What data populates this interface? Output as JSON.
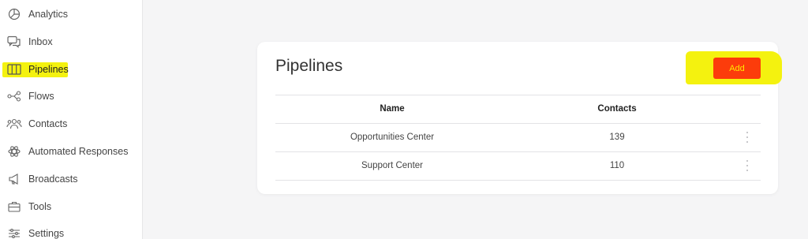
{
  "sidebar": {
    "items": [
      {
        "label": "Analytics",
        "icon": "analytics-icon"
      },
      {
        "label": "Inbox",
        "icon": "inbox-icon"
      },
      {
        "label": "Pipelines",
        "icon": "pipelines-icon",
        "active": true
      },
      {
        "label": "Flows",
        "icon": "flows-icon"
      },
      {
        "label": "Contacts",
        "icon": "contacts-icon"
      },
      {
        "label": "Automated Responses",
        "icon": "automated-responses-icon"
      },
      {
        "label": "Broadcasts",
        "icon": "broadcasts-icon"
      },
      {
        "label": "Tools",
        "icon": "tools-icon"
      },
      {
        "label": "Settings",
        "icon": "settings-icon"
      }
    ]
  },
  "main": {
    "title": "Pipelines",
    "add_label": "Add",
    "table": {
      "columns": [
        "Name",
        "Contacts"
      ],
      "rows": [
        {
          "name": "Opportunities Center",
          "contacts": "139"
        },
        {
          "name": "Support Center",
          "contacts": "110"
        }
      ]
    }
  },
  "colors": {
    "highlight": "#f4f20f",
    "add_button": "#fc3c0b",
    "add_text": "#ffe800"
  }
}
